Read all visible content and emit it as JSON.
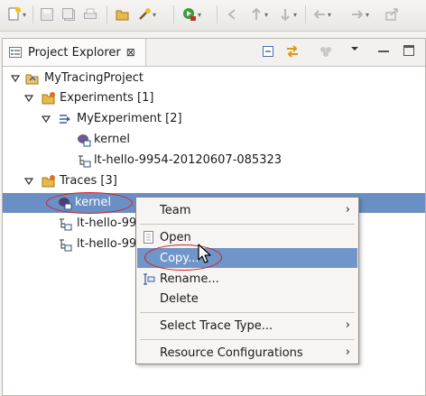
{
  "toolbar": {
    "icons": [
      "new-icon",
      "save-icon",
      "save-all-icon",
      "print-icon",
      "open-folder-icon",
      "tools-icon",
      "run-icon",
      "back-icon",
      "forward-icon",
      "up-icon",
      "down-icon",
      "nav-back-icon",
      "nav-forward-icon",
      "pin-icon"
    ]
  },
  "view": {
    "title": "Project Explorer",
    "close_glyph": "⊠"
  },
  "tree": {
    "project": "MyTracingProject",
    "experiments": "Experiments [1]",
    "experiment": "MyExperiment [2]",
    "exp_kernel": "kernel",
    "exp_trace": "lt-hello-9954-20120607-085323",
    "traces": "Traces [3]",
    "trace_kernel": "kernel",
    "trace2": "lt-hello-99",
    "trace3": "lt-hello-99"
  },
  "context_menu": {
    "team": "Team",
    "open": "Open",
    "copy": "Copy...",
    "rename": "Rename...",
    "delete": "Delete",
    "select_trace_type": "Select Trace Type...",
    "resource_configurations": "Resource Configurations",
    "submenu_arrow": "›"
  },
  "colors": {
    "selection": "#6a8fc4",
    "menu_highlight": "#6f95c9",
    "annotation": "#d42020"
  }
}
